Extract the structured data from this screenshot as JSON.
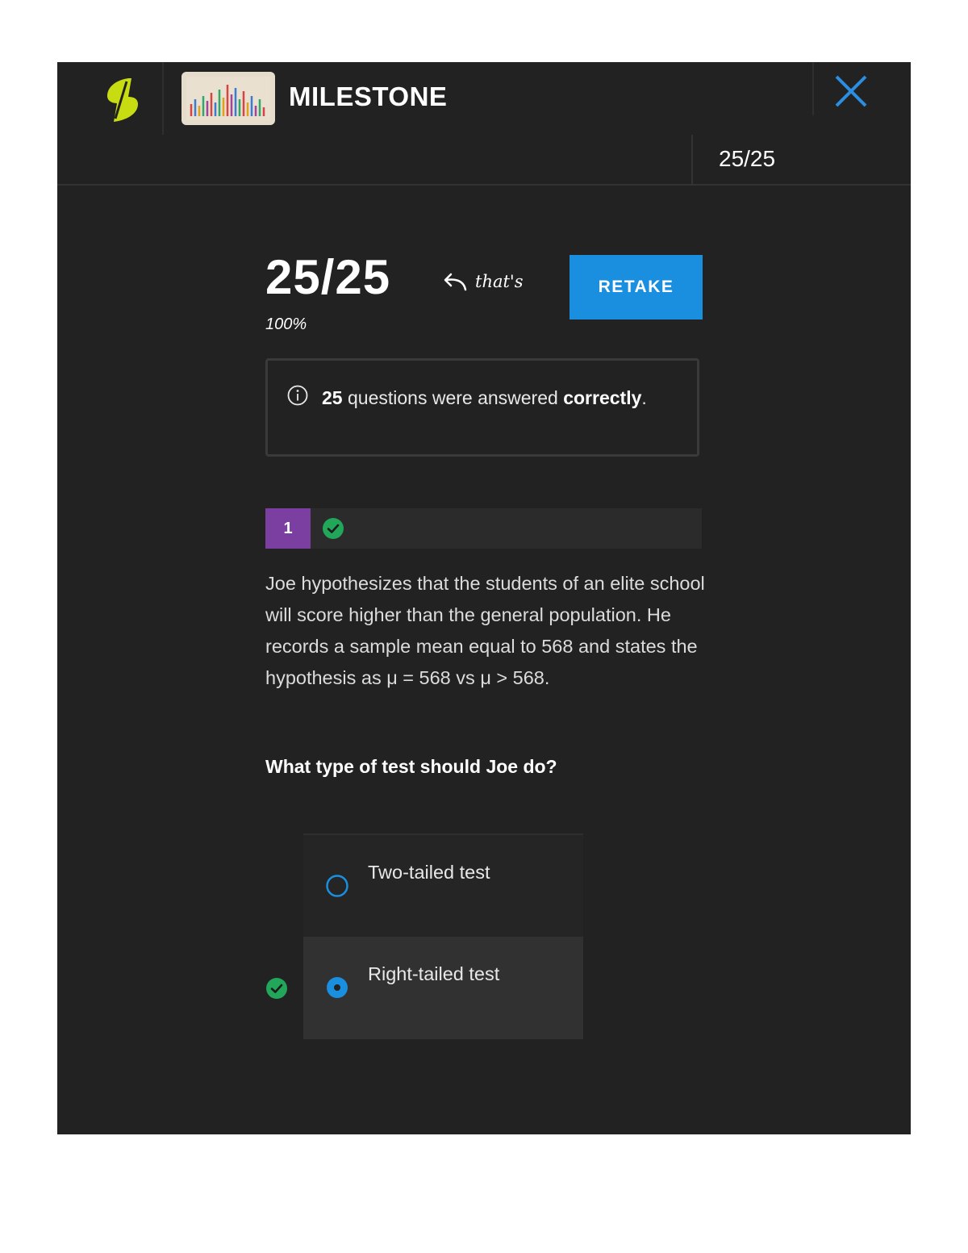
{
  "header": {
    "title": "MILESTONE",
    "progress": "25/25"
  },
  "result": {
    "score": "25/25",
    "note": "that's",
    "percent": "100%",
    "retake_label": "RETAKE"
  },
  "summary": {
    "count": "25",
    "text_middle": "questions were answered",
    "text_bold": "correctly",
    "text_end": "."
  },
  "question": {
    "number": "1",
    "status": "correct",
    "body": "Joe hypothesizes that the students of an elite school will score higher than the general population. He records a sample mean equal to 568 and states the hypothesis as μ  = 568 vs μ > 568.",
    "prompt": "What type of test should Joe do?",
    "options": [
      {
        "label": "Two-tailed test",
        "selected": false
      },
      {
        "label": "Right-tailed test",
        "selected": true
      }
    ]
  },
  "colors": {
    "background": "#222222",
    "accent_blue": "#1a8fe0",
    "logo_green": "#c8dc12",
    "correct_green": "#21a65a",
    "question_badge": "#7b3fa1"
  },
  "icons": [
    "logo-icon",
    "close-icon",
    "arrow-left-icon",
    "info-icon",
    "check-circle-icon",
    "radio-icon"
  ]
}
